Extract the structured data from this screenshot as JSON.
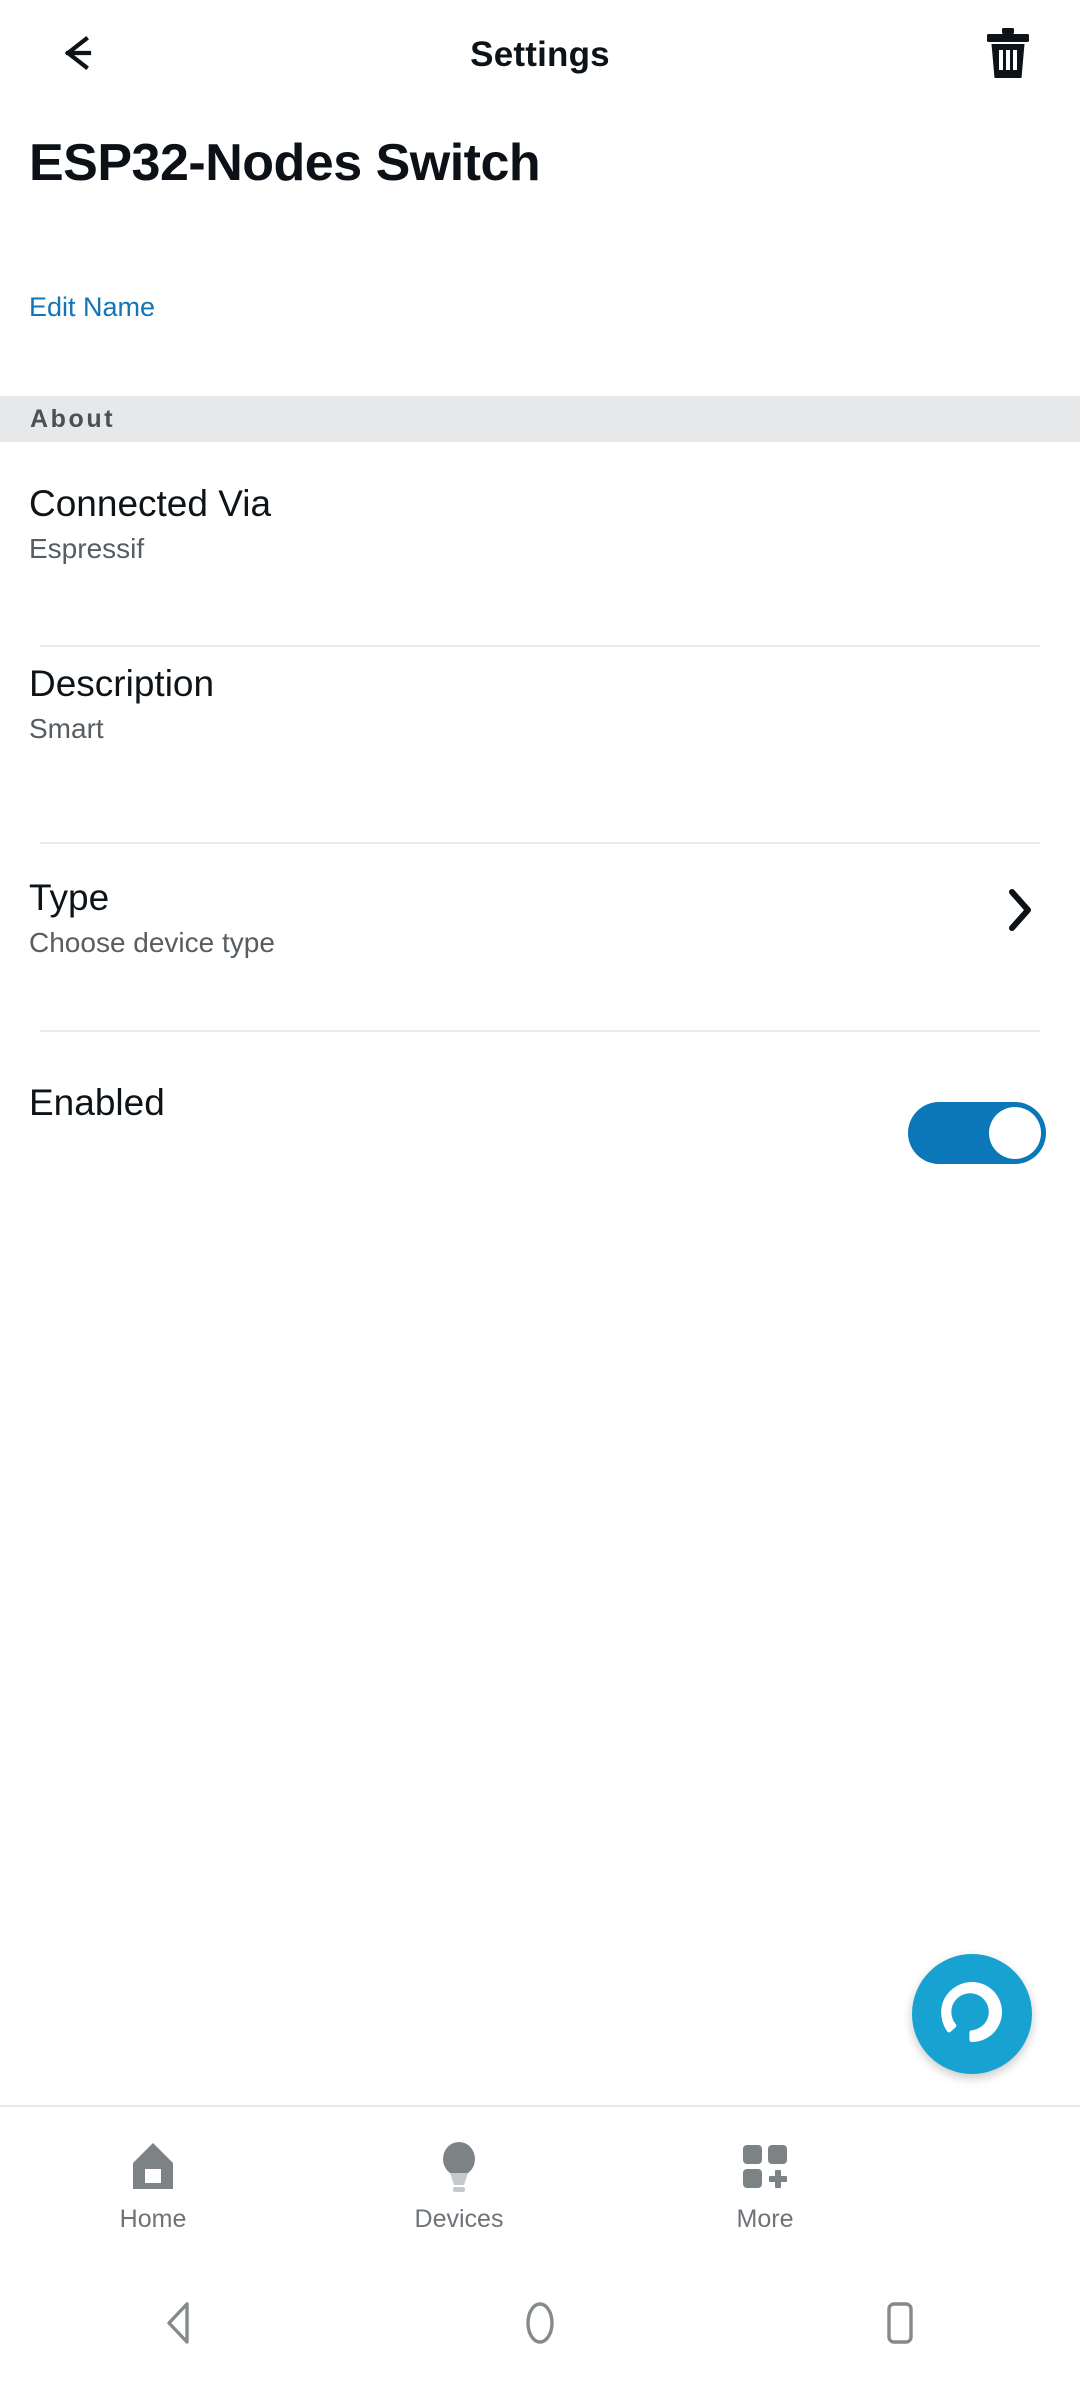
{
  "appbar": {
    "title": "Settings",
    "back_icon": "arrow-left-icon",
    "delete_icon": "trash-icon"
  },
  "device": {
    "name": "ESP32-Nodes Switch",
    "edit_name_label": "Edit Name"
  },
  "section": {
    "about_label": "About"
  },
  "rows": [
    {
      "title": "Connected Via",
      "subtitle": "Espressif"
    },
    {
      "title": "Description",
      "subtitle": "Smart"
    },
    {
      "title": "Type",
      "subtitle": "Choose device type",
      "chevron_icon": "chevron-right-icon"
    },
    {
      "title": "Enabled",
      "toggle_state": "on"
    }
  ],
  "fab": {
    "icon": "alexa-icon",
    "color": "#17A2D2"
  },
  "bottom_nav": {
    "items": [
      {
        "label": "Home",
        "icon": "home-icon"
      },
      {
        "label": "Devices",
        "icon": "bulb-icon"
      },
      {
        "label": "More",
        "icon": "grid-plus-icon"
      }
    ]
  },
  "system_nav": {
    "items": [
      {
        "icon": "android-back-icon"
      },
      {
        "icon": "android-home-icon"
      },
      {
        "icon": "android-recents-icon"
      }
    ]
  },
  "colors": {
    "accent_blue": "#1175B8",
    "toggle_on": "#0B76B8",
    "band_gray": "#E7E8E9",
    "text_primary": "#0D1317",
    "text_secondary": "#585D61",
    "nav_gray": "#7D8285"
  }
}
